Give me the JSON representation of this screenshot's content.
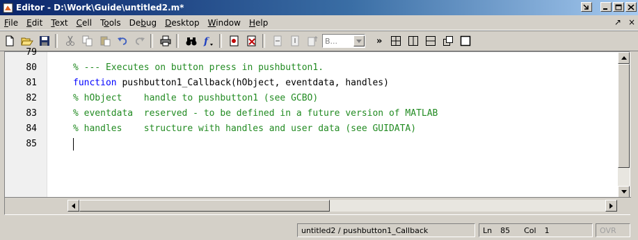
{
  "window": {
    "title": "Editor - D:\\Work\\Guide\\untitled2.m*"
  },
  "menubar": {
    "items": [
      {
        "acc": "F",
        "rest": "ile"
      },
      {
        "acc": "E",
        "rest": "dit"
      },
      {
        "acc": "T",
        "rest": "ext"
      },
      {
        "acc": "C",
        "rest": "ell"
      },
      {
        "pre": "T",
        "acc": "o",
        "rest": "ols"
      },
      {
        "pre": "De",
        "acc": "b",
        "rest": "ug"
      },
      {
        "acc": "D",
        "rest": "esktop"
      },
      {
        "acc": "W",
        "rest": "indow"
      },
      {
        "acc": "H",
        "rest": "elp"
      }
    ],
    "right_arrow": "↗",
    "right_close": "×"
  },
  "toolbar": {
    "stack_value": "B...",
    "overflow": "»"
  },
  "editor": {
    "lines": [
      {
        "num": "79",
        "code": ""
      },
      {
        "num": "80",
        "parts": [
          {
            "t": "% --- Executes on button press in pushbutton1.",
            "c": "cmt"
          }
        ]
      },
      {
        "num": "81",
        "parts": [
          {
            "t": "function",
            "c": "kw"
          },
          {
            "t": " pushbutton1_Callback(hObject, eventdata, handles)",
            "c": ""
          }
        ]
      },
      {
        "num": "82",
        "parts": [
          {
            "t": "% hObject    handle to pushbutton1 (see GCBO)",
            "c": "cmt"
          }
        ]
      },
      {
        "num": "83",
        "parts": [
          {
            "t": "% eventdata  reserved - to be defined in a future version of MATLAB",
            "c": "cmt"
          }
        ]
      },
      {
        "num": "84",
        "parts": [
          {
            "t": "% handles    structure with handles and user data (see GUIDATA)",
            "c": "cmt"
          }
        ]
      },
      {
        "num": "85",
        "parts": []
      }
    ]
  },
  "statusbar": {
    "function": "untitled2 / pushbutton1_Callback",
    "ln_label": "Ln",
    "ln_value": "85",
    "col_label": "Col",
    "col_value": "1",
    "ovr": "OVR"
  }
}
